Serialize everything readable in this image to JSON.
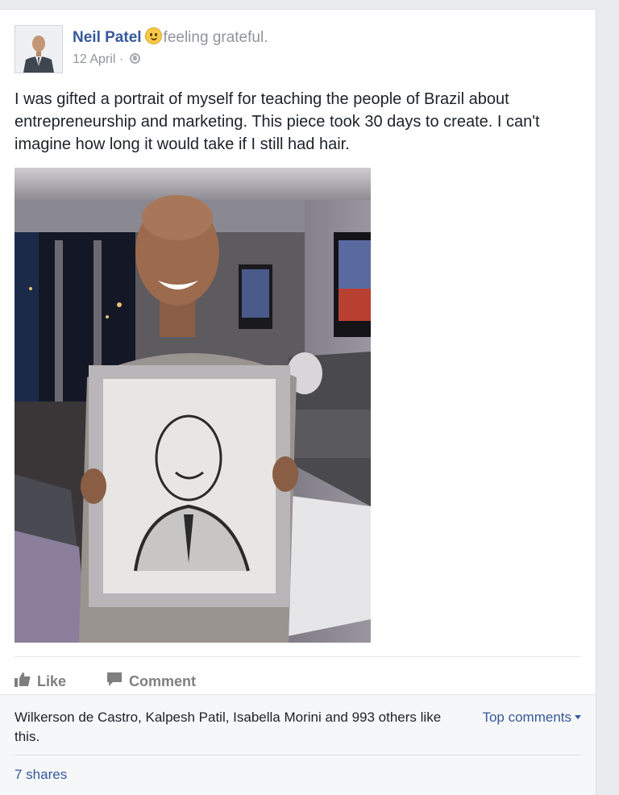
{
  "post": {
    "author": "Neil Patel",
    "feeling": "feeling grateful.",
    "date": "12 April",
    "date_separator": " · ",
    "audience_icon": "globe-icon",
    "text": "I was gifted a portrait of myself for teaching the people of Brazil about entrepreneurship and marketing. This piece took 30 days to create. I can't imagine how long it would take if I still had hair."
  },
  "actions": {
    "like_label": "Like",
    "comment_label": "Comment"
  },
  "summary": {
    "likes_text": "Wilkerson de Castro, Kalpesh Patil, Isabella Morini and 993 others like this.",
    "top_comments_label": "Top comments",
    "shares_label": "7 shares"
  },
  "colors": {
    "link": "#365899",
    "muted": "#90949c",
    "background": "#e9ebee"
  }
}
